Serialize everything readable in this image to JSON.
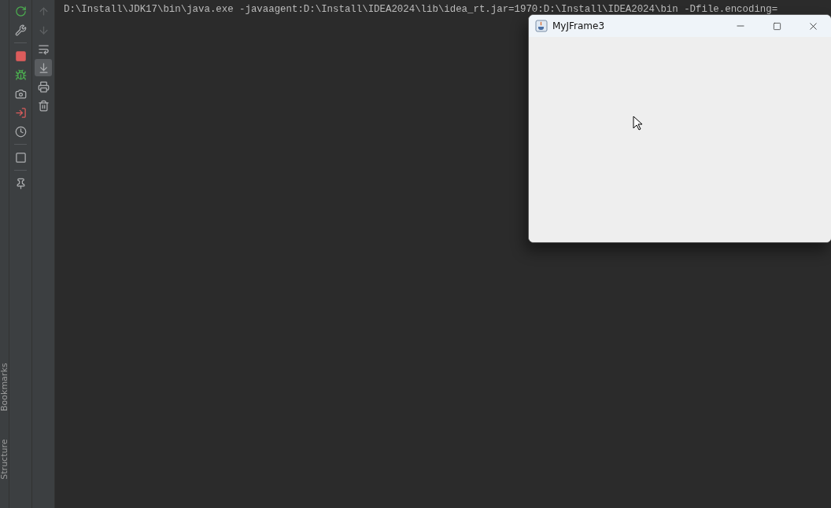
{
  "side_tabs": [
    {
      "label": "Bookmarks"
    },
    {
      "label": "Structure"
    }
  ],
  "console_toolbar": [
    {
      "disabled": true,
      "on": false
    },
    {
      "disabled": true,
      "on": false
    },
    {
      "disabled": false,
      "on": false
    },
    {
      "disabled": false,
      "on": true
    },
    {
      "disabled": false,
      "on": false
    },
    {
      "disabled": false,
      "on": false
    }
  ],
  "console": {
    "lines": [
      "D:\\Install\\JDK17\\bin\\java.exe -javaagent:D:\\Install\\IDEA2024\\lib\\idea_rt.jar=1970:D:\\Install\\IDEA2024\\bin -Dfile.encoding="
    ]
  },
  "window": {
    "title": "MyJFrame3"
  }
}
